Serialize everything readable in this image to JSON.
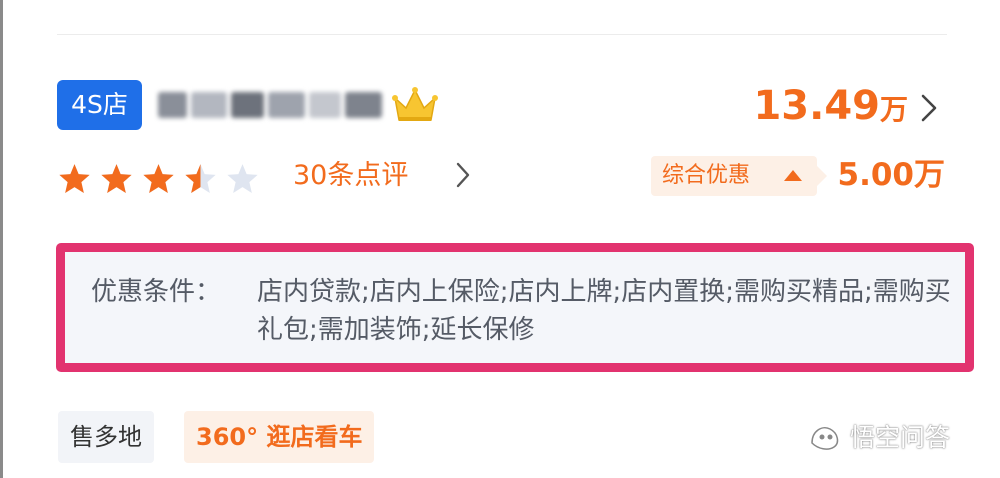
{
  "dealer": {
    "badge": "4S店",
    "name_blurred": true
  },
  "price": {
    "amount": "13.49",
    "unit": "万"
  },
  "rating": {
    "stars": 3.5,
    "max_stars": 5,
    "reviews_label": "30条点评"
  },
  "discount": {
    "tag_label": "综合优惠",
    "amount": "5.00万"
  },
  "conditions": {
    "label": "优惠条件：",
    "value": "店内贷款;店内上保险;店内上牌;店内置换;需购买精品;需购买礼包;需加装饰;延长保修"
  },
  "chips": {
    "area": "售多地",
    "tour": "360° 逛店看车"
  },
  "watermark": {
    "text": "悟空问答",
    "icon": "wukong-logo-icon"
  },
  "colors": {
    "accent": "#f26b1d",
    "badge_blue": "#1f6fe8",
    "highlight_border": "#e2336f",
    "star_orange": "#f26b1d",
    "star_empty": "#dfe5f0"
  }
}
